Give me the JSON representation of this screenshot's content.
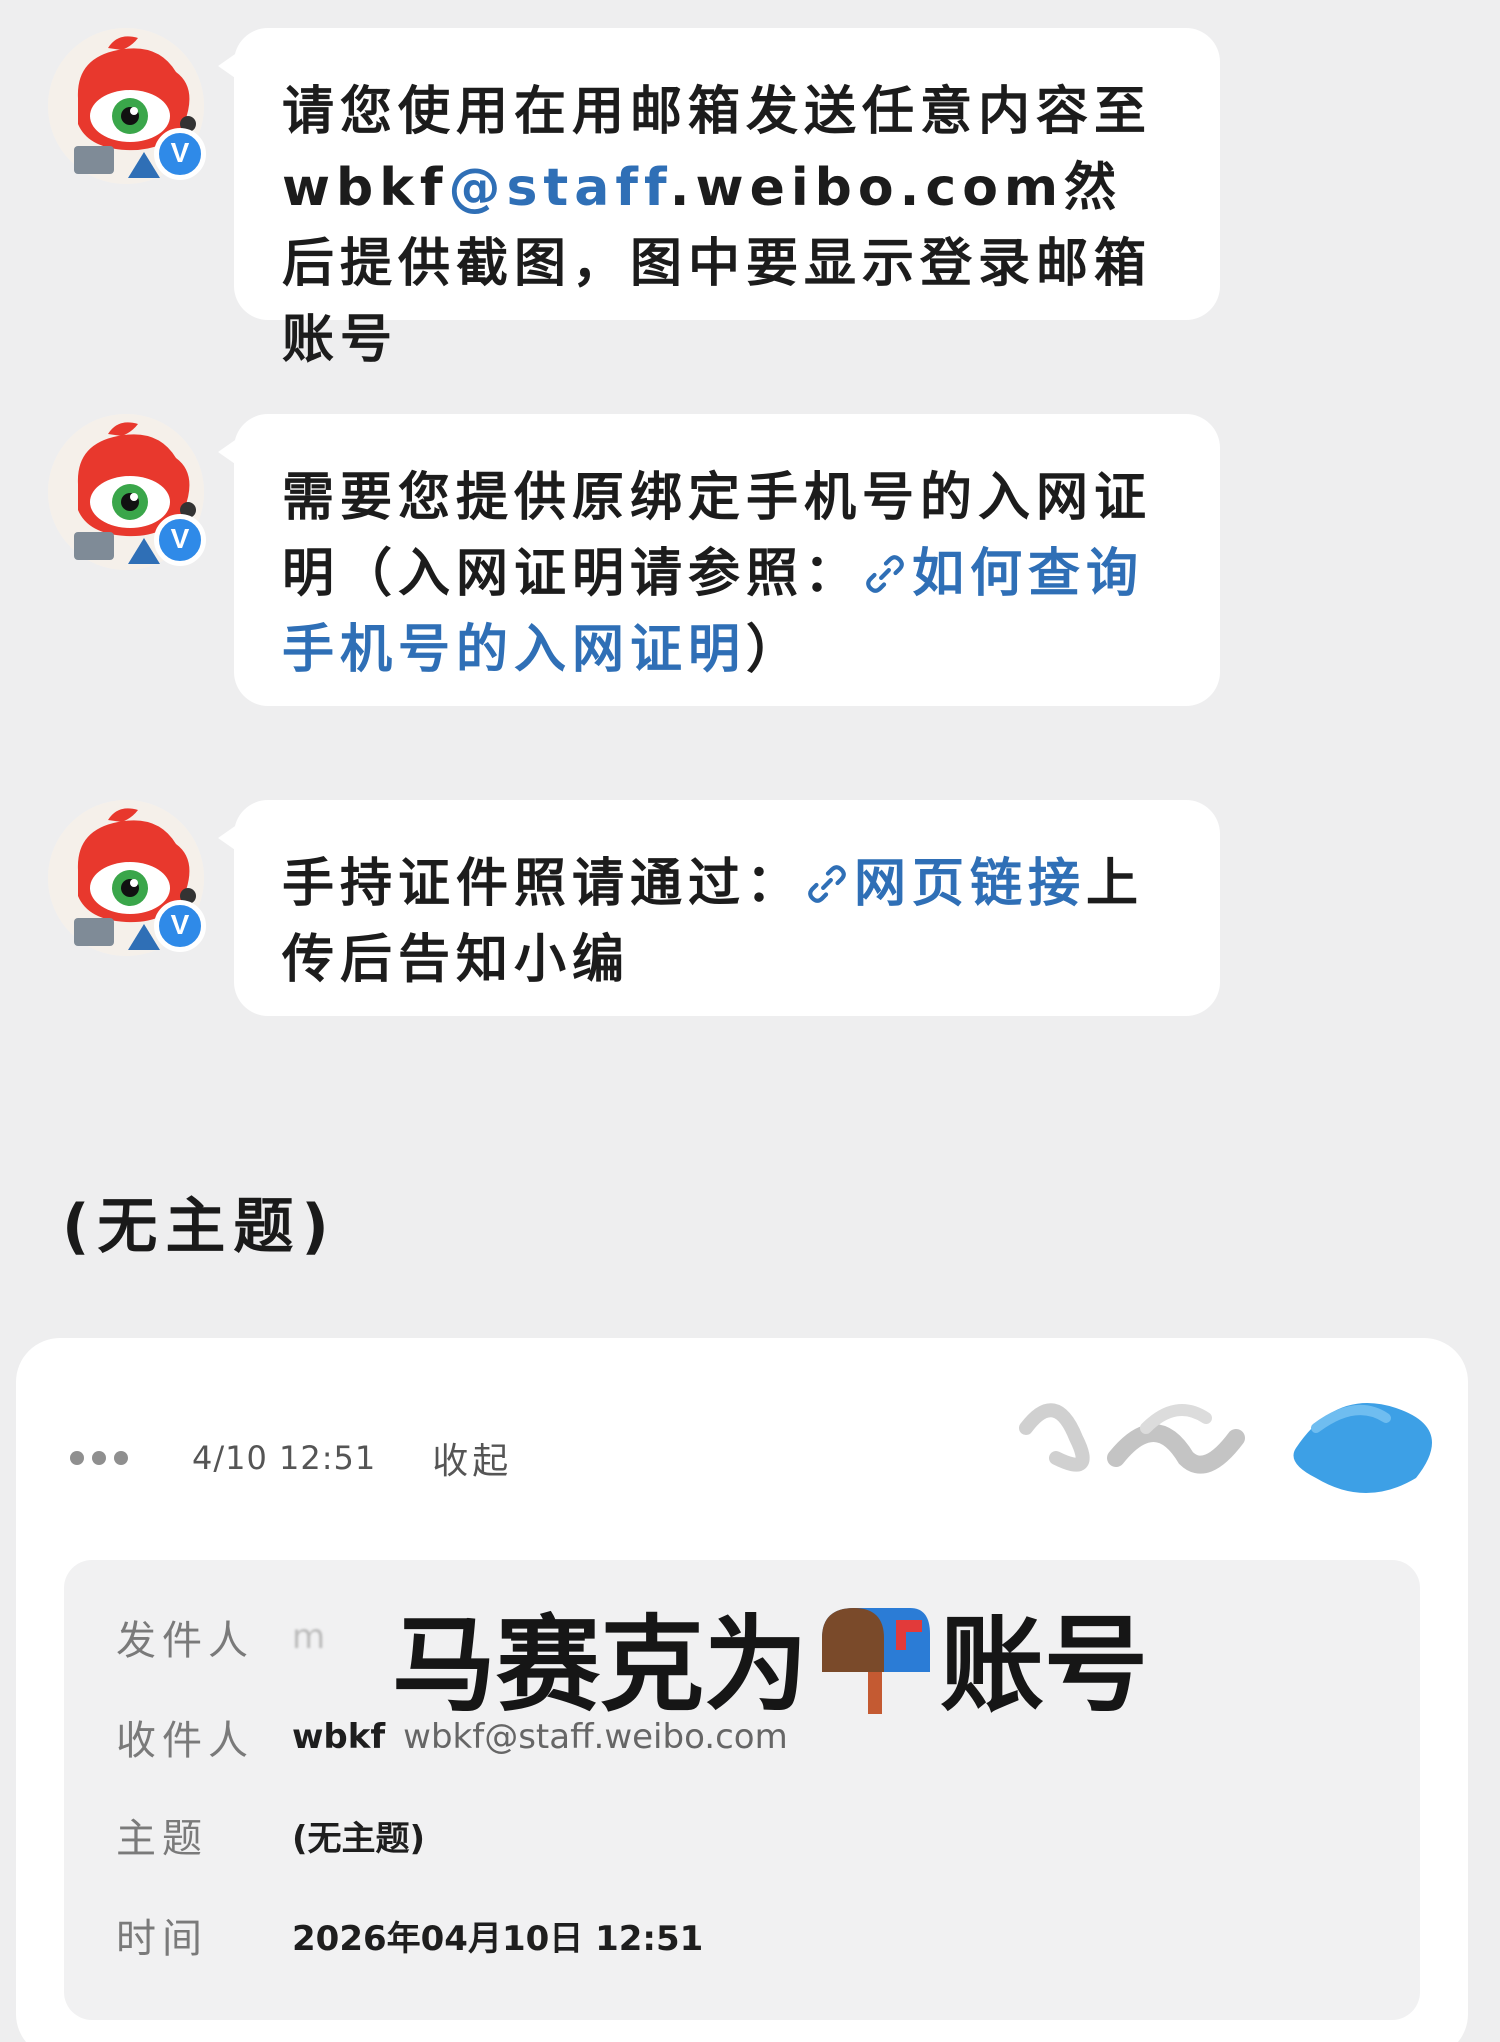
{
  "messages": [
    {
      "parts": [
        {
          "text": "请您使用在用邮箱发送任意内容至wbkf",
          "link": false
        },
        {
          "text": "@staff",
          "link": true
        },
        {
          "text": ".weibo.com然后提供截图，图中要显示登录邮箱账号",
          "link": false
        }
      ]
    },
    {
      "parts": [
        {
          "text": "需要您提供原绑定手机号的入网证明（入网证明请参照：",
          "link": false
        },
        {
          "text": "如何查询手机号的入网证明",
          "link": true,
          "icon": "link-icon"
        },
        {
          "text": "）",
          "link": false
        }
      ]
    },
    {
      "parts": [
        {
          "text": "手持证件照请通过：",
          "link": false
        },
        {
          "text": "网页链接",
          "link": true,
          "icon": "link-icon"
        },
        {
          "text": "上传后告知小编",
          "link": false
        }
      ]
    }
  ],
  "verified_badge": "V",
  "subject_heading": "(无主题)",
  "mail": {
    "time": "4/10  12:51",
    "collapse_label": "收起",
    "overlay": {
      "before": "马赛克为",
      "icon": "mailbox-icon",
      "after": "账号"
    },
    "fields": {
      "from_label": "发件人",
      "from_value": "m",
      "to_label": "收件人",
      "to_name": "wbkf",
      "to_address": "wbkf@staff.weibo.com",
      "subject_label": "主题",
      "subject_value": "(无主题)",
      "time_label": "时间",
      "time_value": "2026年04月10日 12:51"
    }
  },
  "colors": {
    "link": "#2f6fb6",
    "badge": "#2f8ae8",
    "page_bg": "#eeeeef"
  }
}
